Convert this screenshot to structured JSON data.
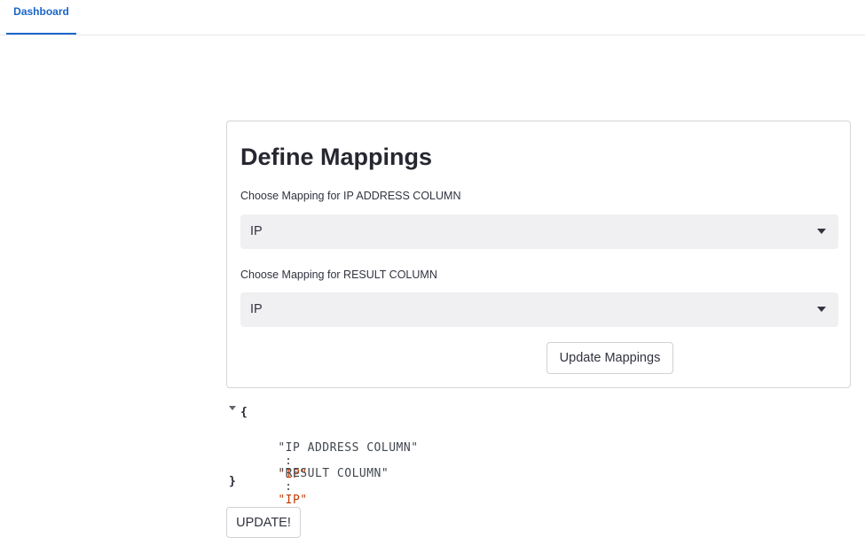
{
  "tabs": [
    {
      "label": "Dashboard",
      "active": true
    }
  ],
  "form": {
    "title": "Define Mappings",
    "fields": [
      {
        "label": "Choose Mapping for IP ADDRESS COLUMN",
        "value": "IP"
      },
      {
        "label": "Choose Mapping for RESULT COLUMN",
        "value": "IP"
      }
    ],
    "submit_label": "Update Mappings"
  },
  "json_view": {
    "open_brace": "{",
    "close_brace": "}",
    "entries": [
      {
        "key": "\"IP ADDRESS COLUMN\"",
        "value": "\"IP\""
      },
      {
        "key": "\"RESULT COLUMN\"",
        "value": "\"IP\""
      }
    ]
  },
  "update_label": "UPDATE!",
  "colors": {
    "accent": "#1a66c9",
    "json_string": "#c23c00",
    "select_bg": "#f0f0f2"
  },
  "icons": {
    "select_caret": "caret-down-icon",
    "json_toggle": "triangle-down-icon"
  }
}
